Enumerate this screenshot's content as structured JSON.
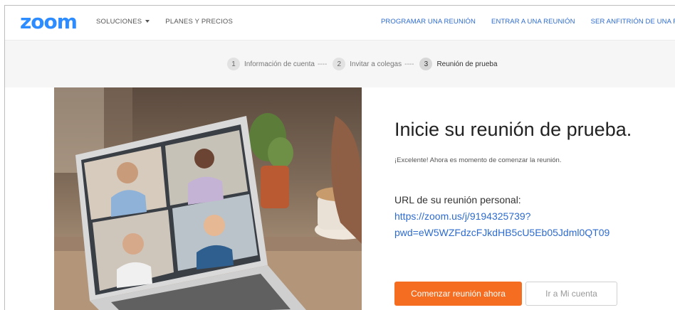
{
  "brand": {
    "logo": "zoom",
    "color": "#2d8cff"
  },
  "nav": {
    "left": [
      {
        "label": "SOLUCIONES",
        "has_dropdown": true
      },
      {
        "label": "PLANES Y PRECIOS"
      }
    ],
    "right": [
      {
        "label": "PROGRAMAR UNA REUNIÓN"
      },
      {
        "label": "ENTRAR A UNA REUNIÓN"
      },
      {
        "label": "SER ANFITRIÓN DE UNA REUNIÓN"
      }
    ]
  },
  "stepper": {
    "steps": [
      {
        "num": "1",
        "label": "Información de cuenta"
      },
      {
        "num": "2",
        "label": "Invitar a colegas"
      },
      {
        "num": "3",
        "label": "Reunión de prueba",
        "active": true
      }
    ],
    "separator": "----"
  },
  "main": {
    "headline": "Inicie su reunión de prueba.",
    "subtitle": "¡Excelente! Ahora es momento de comenzar la reunión.",
    "url_label": "URL de su reunión personal:",
    "url_line1": "https://zoom.us/j/9194325739?",
    "url_line2": "pwd=eW5WZFdzcFJkdHB5cU5Eb05Jdml0QT09",
    "primary_button": "Comenzar reunión ahora",
    "secondary_button": "Ir a Mi cuenta"
  },
  "colors": {
    "accent": "#f56d20",
    "link": "#2d6bcf"
  }
}
